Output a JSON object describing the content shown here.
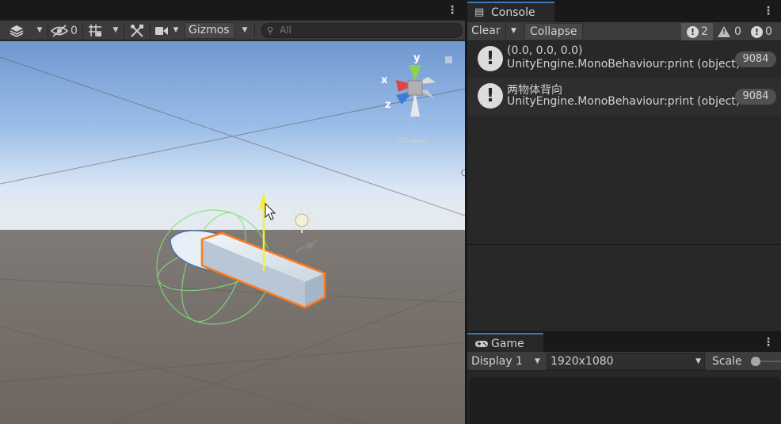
{
  "scene": {
    "toolbar": {
      "hidden_count": "0",
      "gizmos_label": "Gizmos",
      "search_placeholder": "All"
    },
    "gizmo": {
      "axis_x": "x",
      "axis_y": "y",
      "axis_z": "z"
    }
  },
  "console": {
    "tab_label": "Console",
    "clear_label": "Clear",
    "collapse_label": "Collapse",
    "error_count": "2",
    "warning_count": "0",
    "info_count": "0",
    "entries": [
      {
        "line1": "(0.0, 0.0, 0.0)",
        "line2": "UnityEngine.MonoBehaviour:print (object)",
        "count": "9084"
      },
      {
        "line1": "两物体背向",
        "line2": "UnityEngine.MonoBehaviour:print (object)",
        "count": "9084"
      }
    ]
  },
  "game": {
    "tab_label": "Game",
    "display_label": "Display 1",
    "resolution_label": "1920x1080",
    "scale_label": "Scale"
  },
  "colors": {
    "selection_outline": "#ff7a1a",
    "tab_highlight": "#3a79bb",
    "axis_x": "#e0443e",
    "axis_y": "#8cd24c",
    "axis_z": "#3c7bd9",
    "move_handle": "#f4ee3c"
  }
}
